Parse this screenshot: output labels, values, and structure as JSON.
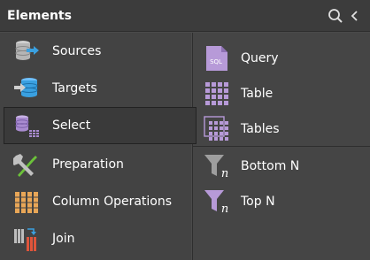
{
  "panel": {
    "title": "Elements"
  },
  "header": {
    "icons": [
      "search-icon",
      "collapse-chevron-icon"
    ]
  },
  "left_items": [
    {
      "label": "Sources",
      "icon": "sources-icon"
    },
    {
      "label": "Targets",
      "icon": "targets-icon"
    },
    {
      "label": "Select",
      "icon": "select-icon",
      "selected": true
    },
    {
      "label": "Preparation",
      "icon": "preparation-icon"
    },
    {
      "label": "Column Operations",
      "icon": "column-operations-icon"
    },
    {
      "label": "Join",
      "icon": "join-icon"
    }
  ],
  "right_items": [
    {
      "label": "Query",
      "icon": "sql-query-icon",
      "icon_text": "SQL"
    },
    {
      "label": "Table",
      "icon": "table-icon"
    },
    {
      "label": "Tables",
      "icon": "tables-icon"
    },
    {
      "label": "Bottom N",
      "icon": "bottom-n-icon",
      "icon_text": "n"
    },
    {
      "label": "Top N",
      "icon": "top-n-icon",
      "icon_text": "n"
    }
  ],
  "colors": {
    "accent_purple": "#b79ad8",
    "accent_blue": "#3aa0e0",
    "accent_orange": "#e8a657",
    "background": "#4a4a4a"
  }
}
